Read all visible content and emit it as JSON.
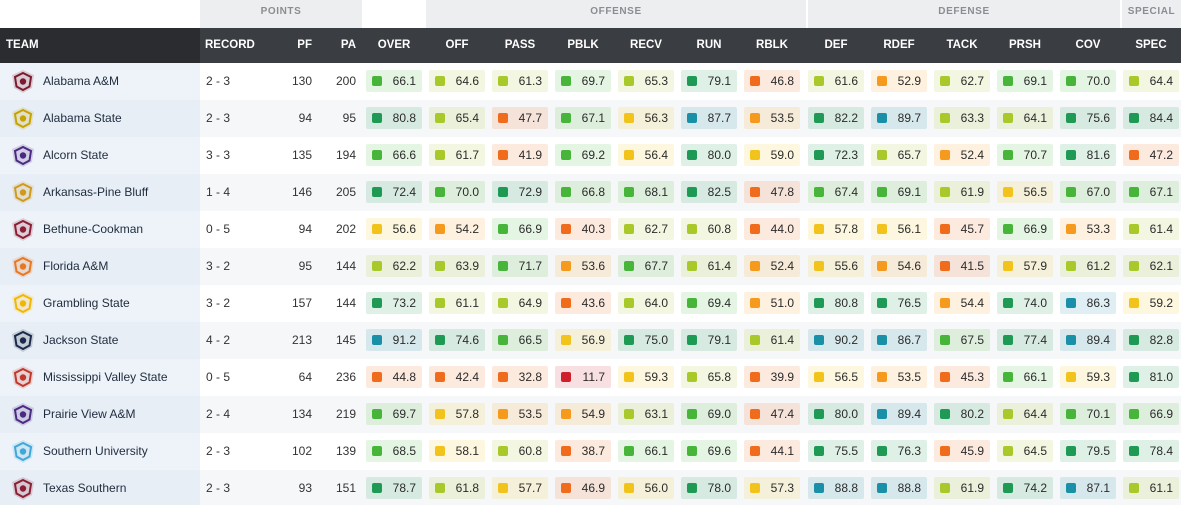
{
  "groups": {
    "points": "POINTS",
    "offense": "OFFENSE",
    "defense": "DEFENSE",
    "special": "SPECIAL"
  },
  "headers": {
    "team": "TEAM",
    "record": "RECORD",
    "pf": "PF",
    "pa": "PA",
    "grades": [
      "OVER",
      "OFF",
      "PASS",
      "PBLK",
      "RECV",
      "RUN",
      "RBLK",
      "DEF",
      "RDEF",
      "TACK",
      "PRSH",
      "COV",
      "SPEC"
    ]
  },
  "grade_colors": {
    "teal": "#1a8fa8",
    "dark_green": "#1f9a55",
    "green": "#47b53a",
    "lime": "#a9c92a",
    "yellow": "#f2c31b",
    "orange": "#f59a1c",
    "dark_orange": "#f06b1b",
    "red": "#cf1f2b"
  },
  "teams": [
    {
      "name": "Alabama A&M",
      "logo": "alabama-am-logo",
      "logo_color": "#7a1c2e",
      "record": "2 - 3",
      "pf": "130",
      "pa": "200",
      "grades": [
        "66.1",
        "64.6",
        "61.3",
        "69.7",
        "65.3",
        "79.1",
        "46.8",
        "61.6",
        "52.9",
        "62.7",
        "69.1",
        "70.0",
        "64.4"
      ]
    },
    {
      "name": "Alabama State",
      "logo": "alabama-state-logo",
      "logo_color": "#c8a200",
      "record": "2 - 3",
      "pf": "94",
      "pa": "95",
      "grades": [
        "80.8",
        "65.4",
        "47.7",
        "67.1",
        "56.3",
        "87.7",
        "53.5",
        "82.2",
        "89.7",
        "63.3",
        "64.1",
        "75.6",
        "84.4"
      ]
    },
    {
      "name": "Alcorn State",
      "logo": "alcorn-state-logo",
      "logo_color": "#4b2a83",
      "record": "3 - 3",
      "pf": "135",
      "pa": "194",
      "grades": [
        "66.6",
        "61.7",
        "41.9",
        "69.2",
        "56.4",
        "80.0",
        "59.0",
        "72.3",
        "65.7",
        "52.4",
        "70.7",
        "81.6",
        "47.2"
      ]
    },
    {
      "name": "Arkansas-Pine Bluff",
      "logo": "arkansas-pine-bluff-logo",
      "logo_color": "#d09a1f",
      "record": "1 - 4",
      "pf": "146",
      "pa": "205",
      "grades": [
        "72.4",
        "70.0",
        "72.9",
        "66.8",
        "68.1",
        "82.5",
        "47.8",
        "67.4",
        "69.1",
        "61.9",
        "56.5",
        "67.0",
        "67.1"
      ]
    },
    {
      "name": "Bethune-Cookman",
      "logo": "bethune-cookman-logo",
      "logo_color": "#8b1f35",
      "record": "0 - 5",
      "pf": "94",
      "pa": "202",
      "grades": [
        "56.6",
        "54.2",
        "66.9",
        "40.3",
        "62.7",
        "60.8",
        "44.0",
        "57.8",
        "56.1",
        "45.7",
        "66.9",
        "53.3",
        "61.4"
      ]
    },
    {
      "name": "Florida A&M",
      "logo": "florida-am-logo",
      "logo_color": "#e87722",
      "record": "3 - 2",
      "pf": "95",
      "pa": "144",
      "grades": [
        "62.2",
        "63.9",
        "71.7",
        "53.6",
        "67.7",
        "61.4",
        "52.4",
        "55.6",
        "54.6",
        "41.5",
        "57.9",
        "61.2",
        "62.1"
      ]
    },
    {
      "name": "Grambling State",
      "logo": "grambling-state-logo",
      "logo_color": "#f2b705",
      "record": "3 - 2",
      "pf": "157",
      "pa": "144",
      "grades": [
        "73.2",
        "61.1",
        "64.9",
        "43.6",
        "64.0",
        "69.4",
        "51.0",
        "80.8",
        "76.5",
        "54.4",
        "74.0",
        "86.3",
        "59.2"
      ]
    },
    {
      "name": "Jackson State",
      "logo": "jackson-state-logo",
      "logo_color": "#1b2a4a",
      "record": "4 - 2",
      "pf": "213",
      "pa": "145",
      "grades": [
        "91.2",
        "74.6",
        "66.5",
        "56.9",
        "75.0",
        "79.1",
        "61.4",
        "90.2",
        "86.7",
        "67.5",
        "77.4",
        "89.4",
        "82.8"
      ]
    },
    {
      "name": "Mississippi Valley State",
      "logo": "mississippi-valley-state-logo",
      "logo_color": "#c0392b",
      "record": "0 - 5",
      "pf": "64",
      "pa": "236",
      "grades": [
        "44.8",
        "42.4",
        "32.8",
        "11.7",
        "59.3",
        "65.8",
        "39.9",
        "56.5",
        "53.5",
        "45.3",
        "66.1",
        "59.3",
        "81.0"
      ]
    },
    {
      "name": "Prairie View A&M",
      "logo": "prairie-view-am-logo",
      "logo_color": "#4b2a83",
      "record": "2 - 4",
      "pf": "134",
      "pa": "219",
      "grades": [
        "69.7",
        "57.8",
        "53.5",
        "54.9",
        "63.1",
        "69.0",
        "47.4",
        "80.0",
        "89.4",
        "80.2",
        "64.4",
        "70.1",
        "66.9"
      ]
    },
    {
      "name": "Southern University",
      "logo": "southern-university-logo",
      "logo_color": "#3fa8d8",
      "record": "2 - 3",
      "pf": "102",
      "pa": "139",
      "grades": [
        "68.5",
        "58.1",
        "60.8",
        "38.7",
        "66.1",
        "69.6",
        "44.1",
        "75.5",
        "76.3",
        "45.9",
        "64.5",
        "79.5",
        "78.4"
      ]
    },
    {
      "name": "Texas Southern",
      "logo": "texas-southern-logo",
      "logo_color": "#8b1f35",
      "record": "2 - 3",
      "pf": "93",
      "pa": "151",
      "grades": [
        "78.7",
        "61.8",
        "57.7",
        "46.9",
        "56.0",
        "78.0",
        "57.3",
        "88.8",
        "88.8",
        "61.9",
        "74.2",
        "87.1",
        "61.1"
      ]
    }
  ]
}
